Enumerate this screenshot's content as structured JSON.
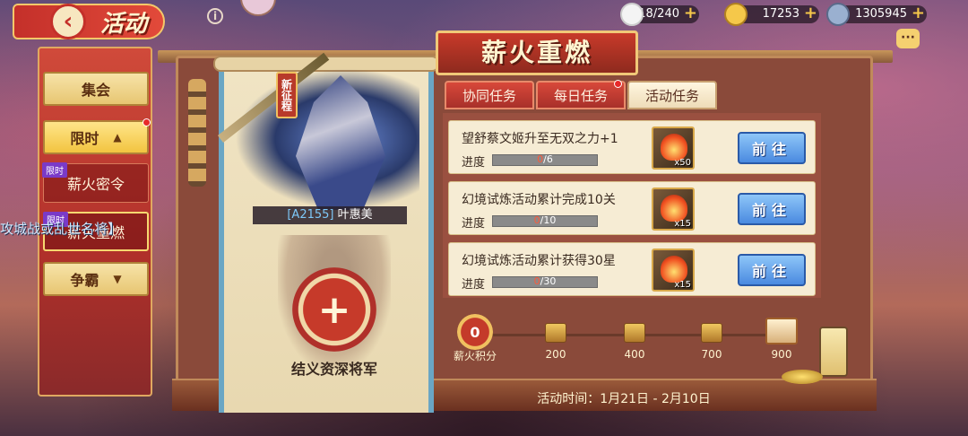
{
  "header": {
    "back_icon": "chevron-left-icon",
    "title": "活动",
    "resources": [
      {
        "icon": "rice-icon",
        "value": "18/240",
        "color": "#ffffff"
      },
      {
        "icon": "gold-ingot-icon",
        "value": "17253",
        "color": "#f5c84a"
      },
      {
        "icon": "coin-icon",
        "value": "1305945",
        "color": "#9ab0d0"
      }
    ]
  },
  "menu": {
    "items": [
      {
        "label": "集会"
      },
      {
        "label": "限时",
        "caret": "▲"
      },
      {
        "label": "薪火密令",
        "tag": "限时"
      },
      {
        "label": "薪火重燃",
        "tag": "限时"
      },
      {
        "label": "争霸",
        "caret": "▼"
      }
    ]
  },
  "marquee": "攻城战或乱世名将】",
  "event": {
    "title": "薪火重燃",
    "tabs": [
      {
        "label": "协同任务",
        "active": false
      },
      {
        "label": "每日任务",
        "active": false
      },
      {
        "label": "活动任务",
        "active": true
      }
    ],
    "hero": {
      "badge": "新征程",
      "code": "[A2155]",
      "name": "叶惠美"
    },
    "recruit_label": "结义资深将军",
    "recruit_plus": "+",
    "tasks": [
      {
        "title": "望舒蔡文姬升至无双之力+1",
        "progress_label": "进度",
        "current": "0",
        "total": "/6",
        "progress": 0,
        "reward_icon": "fire-icon",
        "reward_count": "x50",
        "button": "前往"
      },
      {
        "title": "幻境试炼活动累计完成10关",
        "progress_label": "进度",
        "current": "0",
        "total": "/10",
        "progress": 0,
        "reward_icon": "fire-icon",
        "reward_count": "x15",
        "button": "前往"
      },
      {
        "title": "幻境试炼活动累计获得30星",
        "progress_label": "进度",
        "current": "0",
        "total": "/30",
        "progress": 0,
        "reward_icon": "fire-icon",
        "reward_count": "x15",
        "button": "前往"
      }
    ],
    "points": {
      "value": "0",
      "label": "薪火积分"
    },
    "milestones": [
      "200",
      "400",
      "700",
      "900"
    ],
    "time": "活动时间：1月21日 - 2月10日"
  }
}
